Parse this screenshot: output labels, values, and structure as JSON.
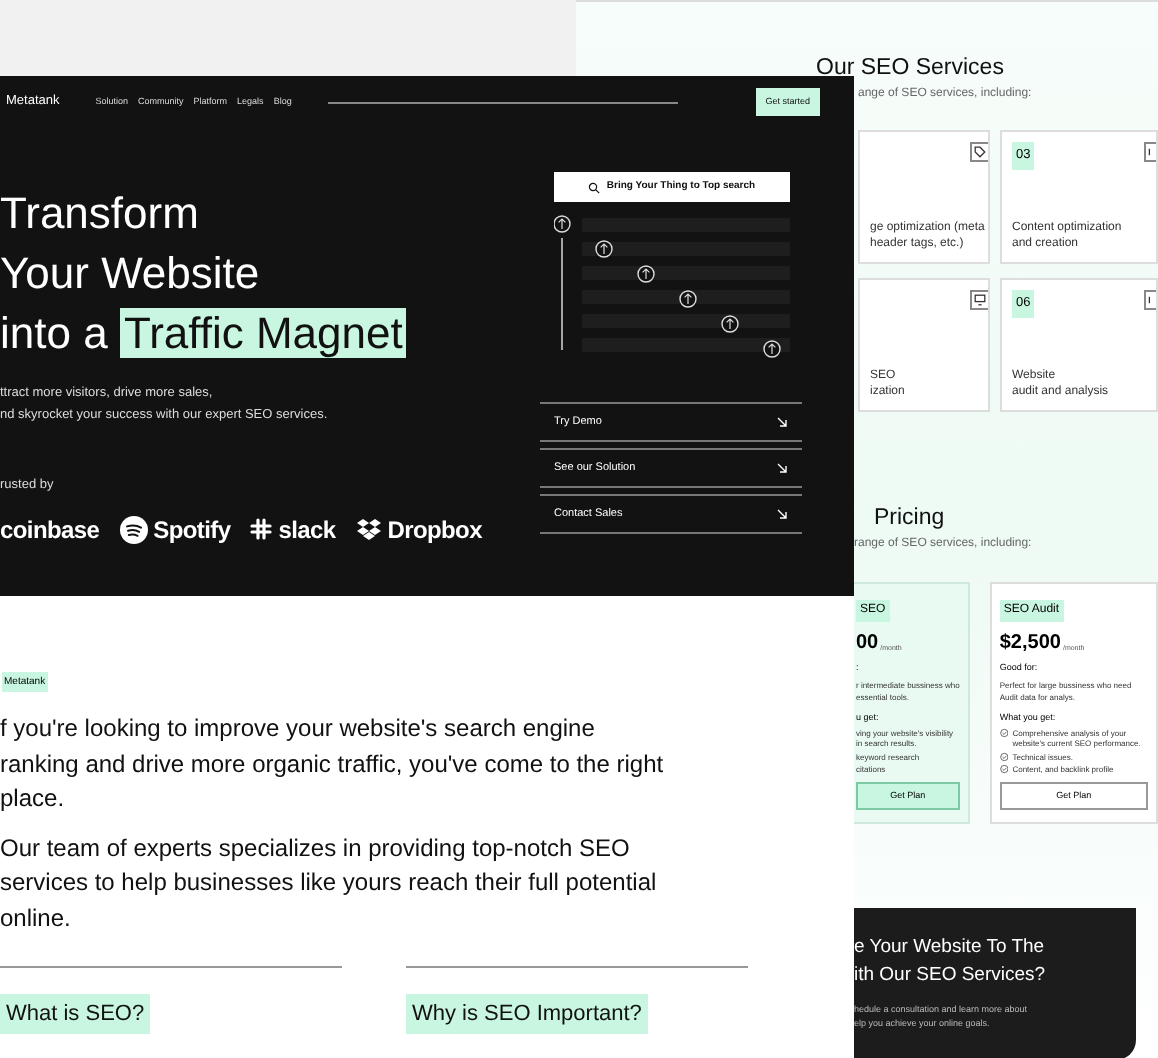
{
  "services_page": {
    "title": "Our SEO Services",
    "subtitle": "ange of SEO services, including:",
    "cards": [
      {
        "kind": "tag",
        "lines": [
          "ge optimization (meta",
          "header tags, etc.)"
        ]
      },
      {
        "number": "03",
        "kind": "edge",
        "lines": [
          "Content optimization",
          "and creation"
        ]
      },
      {
        "kind": "monitor",
        "lines": [
          "SEO",
          "ization"
        ]
      },
      {
        "number": "06",
        "kind": "edge",
        "lines": [
          "Website",
          "audit and analysis"
        ]
      }
    ],
    "pricing": {
      "title": "Pricing",
      "subtitle": "range of SEO services, including:",
      "plans": [
        {
          "highlighted": true,
          "badge": "SEO",
          "price": "00",
          "period": "/month",
          "good_for": ":",
          "description": [
            "r intermediate bussiness who",
            "essential tools."
          ],
          "get_label": "u get:",
          "features": [
            {
              "text": "ving your website's visibility in search results.",
              "check": false
            },
            {
              "text": "keyword research",
              "check": false
            },
            {
              "text": "citations",
              "check": false
            }
          ],
          "button": "Get Plan"
        },
        {
          "highlighted": false,
          "badge": "SEO Audit",
          "price": "$2,500",
          "period": "/month",
          "good_for": "Good for:",
          "description": [
            "Perfect for large bussiness who need",
            "Audit data for analys."
          ],
          "get_label": "What you get:",
          "features": [
            {
              "text": "Comprehensive analysis of your website's current SEO performance.",
              "check": true
            },
            {
              "text": "Technical issues.",
              "check": true
            },
            {
              "text": "Content, and backlink profile",
              "check": true
            }
          ],
          "button": "Get Plan"
        }
      ]
    },
    "cta": {
      "title_lines": [
        "e Your Website To The",
        "ith Our SEO Services?"
      ],
      "text_lines": [
        "hedule a consultation and learn more about",
        "elp you achieve your online goals."
      ]
    }
  },
  "hero": {
    "brand": "Metatank",
    "nav": [
      "Solution",
      "Community",
      "Platform",
      "Legals",
      "Blog"
    ],
    "get_started": "Get started",
    "title_lines": [
      "Transform",
      "Your Website"
    ],
    "title_prefix": "into a",
    "highlight": "Traffic Magnet",
    "subtitle_lines": [
      "ttract more visitors, drive more sales,",
      "nd skyrocket your success with our expert SEO services."
    ],
    "trusted_label": "rusted by",
    "logos": [
      {
        "kind": "coinbase",
        "name": "coinbase"
      },
      {
        "kind": "spotify",
        "name": "Spotify"
      },
      {
        "kind": "slack",
        "name": "slack"
      },
      {
        "kind": "dropbox",
        "name": "Dropbox"
      }
    ],
    "search_button": "Bring Your Thing to Top search",
    "actions": [
      "Try Demo",
      "See our Solution",
      "Contact Sales"
    ]
  },
  "about": {
    "tag": "Metatank",
    "paragraphs": [
      [
        "f you're looking to improve your website's search engine",
        "ranking and drive more organic traffic, you've come to the right",
        "place."
      ],
      [
        "Our team of experts specializes in providing top-notch SEO",
        "services to help businesses like yours reach their full potential",
        "online."
      ]
    ],
    "faq": [
      "What is SEO?",
      "Why is SEO Important?"
    ]
  }
}
